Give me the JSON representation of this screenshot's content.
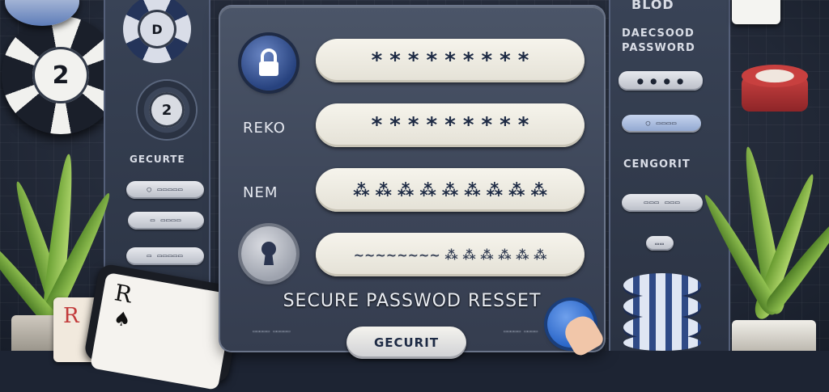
{
  "left_panel": {
    "label": "GECURTE",
    "mini_buttons": [
      "◯ ▭▭▭▭▭",
      "▭ ▭▭▭▭",
      "▭ ▭▭▭▭▭"
    ]
  },
  "right_panel": {
    "top_label": "BLOD",
    "title_line1": "DAECSOOD",
    "title_line2": "PASSWORD",
    "dots_button": "● ● ● ●",
    "small_button_1": "◯ ▭▭▭▭",
    "mid_label": "CENGORIT",
    "small_button_2": "▭▭▭ ▭▭▭",
    "small_icon": "▭▭"
  },
  "chips": {
    "left_big": "2",
    "left_small_top": "D",
    "left_small_mid": "2"
  },
  "main": {
    "fields": [
      {
        "label": "",
        "value": "* * * * * * * * *"
      },
      {
        "label": "REKO",
        "value": "* * * * * * * * *"
      },
      {
        "label": "NEM",
        "value": "⁂ ⁂ ⁂ ⁂ ⁂ ⁂ ⁂ ⁂ ⁂"
      },
      {
        "label": "",
        "value": "~~~~~~~~ ⁂ ⁂ ⁂ ⁂ ⁂ ⁂"
      }
    ],
    "heading": "SECURE PASSWOD RESSET",
    "submit_label": "GECURIT",
    "hint_left": "▭▭▭▭▭ ▭▭▭▭▭",
    "hint_right": "▭▭▭▭▭ ▭▭▭▭"
  },
  "cards": {
    "front_rank": "R",
    "back_rank": "R",
    "suit": "♠"
  },
  "colors": {
    "accent_blue": "#2a66c9",
    "field_bg": "#f1efe6",
    "panel": "#3c4558"
  }
}
